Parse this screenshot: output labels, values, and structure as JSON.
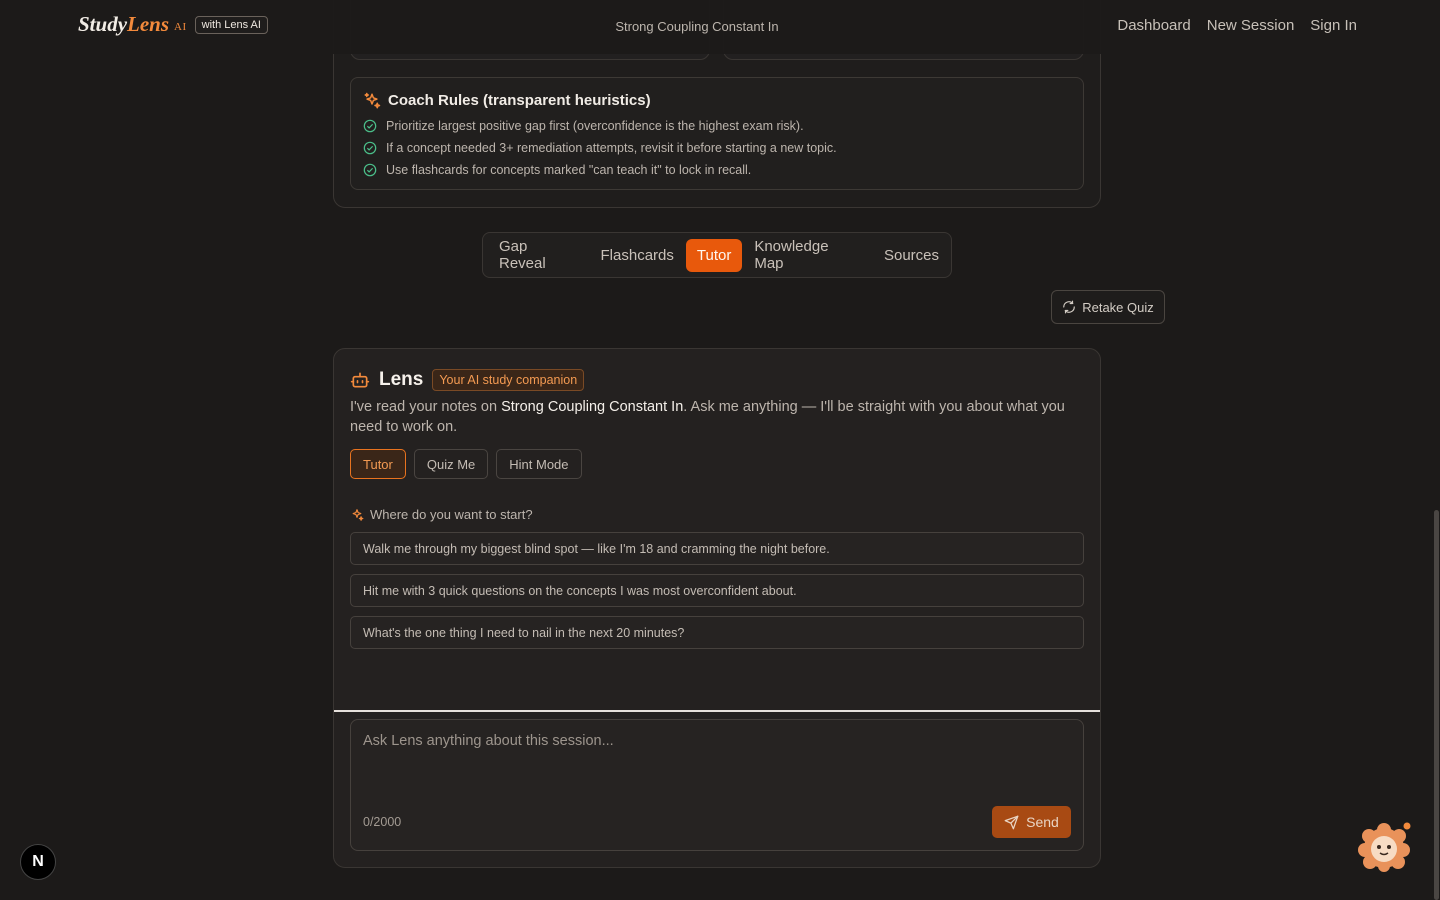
{
  "navbar": {
    "brand_study": "Study",
    "brand_lens": "Lens",
    "brand_ai": "AI",
    "brand_badge": "with Lens AI",
    "session_title": "Strong Coupling Constant In",
    "links": [
      "Dashboard",
      "New Session",
      "Sign In"
    ]
  },
  "coach": {
    "title": "Coach Rules (transparent heuristics)",
    "rules": [
      "Prioritize largest positive gap first (overconfidence is the highest exam risk).",
      "If a concept needed 3+ remediation attempts, revisit it before starting a new topic.",
      "Use flashcards for concepts marked \"can teach it\" to lock in recall."
    ]
  },
  "tabs": [
    "Gap Reveal",
    "Flashcards",
    "Tutor",
    "Knowledge Map",
    "Sources"
  ],
  "active_tab": "Tutor",
  "retake_label": "Retake Quiz",
  "lens": {
    "name": "Lens",
    "tag": "Your AI study companion",
    "intro_before": "I've read your notes on ",
    "intro_topic": "Strong Coupling Constant In",
    "intro_after": ". Ask me anything — I'll be straight with you about what you need to work on.",
    "modes": [
      "Tutor",
      "Quiz Me",
      "Hint Mode"
    ],
    "active_mode": "Tutor",
    "start_prompt": "Where do you want to start?",
    "suggestions": [
      "Walk me through my biggest blind spot — like I'm 18 and cramming the night before.",
      "Hit me with 3 quick questions on the concepts I was most overconfident about.",
      "What's the one thing I need to nail in the next 20 minutes?"
    ],
    "input_placeholder": "Ask Lens anything about this session...",
    "char_count": "0/2000",
    "send_label": "Send"
  },
  "floating": {
    "next_badge": "N"
  },
  "colors": {
    "accent": "#e8590c",
    "accent_text": "#f39a52",
    "check": "#4bbf8a",
    "background": "#1c1a19"
  }
}
